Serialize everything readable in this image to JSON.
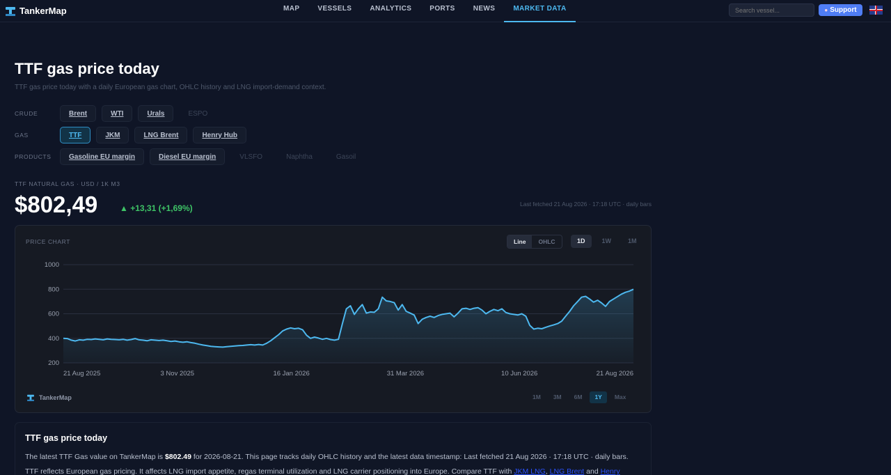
{
  "nav": {
    "brand": "TankerMap",
    "links": [
      "MAP",
      "VESSELS",
      "ANALYTICS",
      "PORTS",
      "NEWS",
      "MARKET DATA"
    ],
    "active": "MARKET DATA",
    "search_placeholder": "Search vessel...",
    "support_label": "Support"
  },
  "header": {
    "title": "TTF gas price today",
    "subtitle": "TTF gas price today with a daily European gas chart, OHLC history and LNG import-demand context."
  },
  "selector": {
    "crude_label": "CRUDE",
    "crude": [
      "Brent",
      "WTI",
      "Urals",
      "ESPO"
    ],
    "gas_label": "GAS",
    "gas": [
      "TTF",
      "JKM",
      "LNG Brent",
      "Henry Hub"
    ],
    "products_label": "PRODUCTS",
    "products": [
      "Gasoline EU margin",
      "Diesel EU margin",
      "VLSFO",
      "Naphtha",
      "Gasoil"
    ]
  },
  "quote": {
    "instrument": "TTF NATURAL GAS · USD / 1K M3",
    "price": "$802,49",
    "change": "▲ +13,31 (+1,69%)",
    "fetched": "Last fetched 21 Aug 2026 · 17:18 UTC · daily bars"
  },
  "chart_panel": {
    "label": "PRICE CHART",
    "modes": [
      "Line",
      "OHLC"
    ],
    "intervals": [
      "1D",
      "1W",
      "1M"
    ],
    "brand": "TankerMap",
    "ranges": [
      "1M",
      "3M",
      "6M",
      "1Y",
      "Max"
    ],
    "accent": "#4db8ef"
  },
  "chart_data": {
    "type": "area",
    "title": "",
    "xlabel": "",
    "ylabel": "",
    "ylim": [
      200,
      1000
    ],
    "yticks": [
      1000,
      800,
      600,
      400,
      200
    ],
    "xtick_labels": [
      "21 Aug 2025",
      "3 Nov 2025",
      "16 Jan 2026",
      "31 Mar 2026",
      "10 Jun 2026",
      "21 Aug 2026"
    ],
    "grid": true,
    "series": [
      {
        "values": [
          400,
          398,
          385,
          378,
          388,
          385,
          392,
          390,
          395,
          392,
          388,
          395,
          392,
          390,
          388,
          392,
          385,
          390,
          398,
          388,
          385,
          380,
          388,
          385,
          382,
          385,
          380,
          375,
          378,
          372,
          368,
          372,
          365,
          360,
          352,
          345,
          340,
          335,
          332,
          330,
          328,
          332,
          335,
          338,
          340,
          342,
          345,
          348,
          345,
          350,
          345,
          360,
          380,
          405,
          430,
          460,
          475,
          485,
          478,
          482,
          470,
          425,
          400,
          410,
          402,
          392,
          400,
          390,
          385,
          392,
          520,
          640,
          665,
          595,
          640,
          675,
          605,
          615,
          612,
          640,
          735,
          705,
          700,
          690,
          630,
          675,
          620,
          605,
          590,
          520,
          555,
          570,
          580,
          570,
          585,
          595,
          600,
          605,
          575,
          605,
          640,
          645,
          635,
          645,
          650,
          630,
          600,
          620,
          635,
          625,
          640,
          610,
          600,
          595,
          590,
          600,
          580,
          505,
          475,
          482,
          478,
          490,
          500,
          510,
          520,
          540,
          580,
          620,
          665,
          700,
          735,
          742,
          720,
          695,
          710,
          688,
          660,
          700,
          720,
          740,
          760,
          775,
          785,
          800
        ]
      }
    ]
  }
}
